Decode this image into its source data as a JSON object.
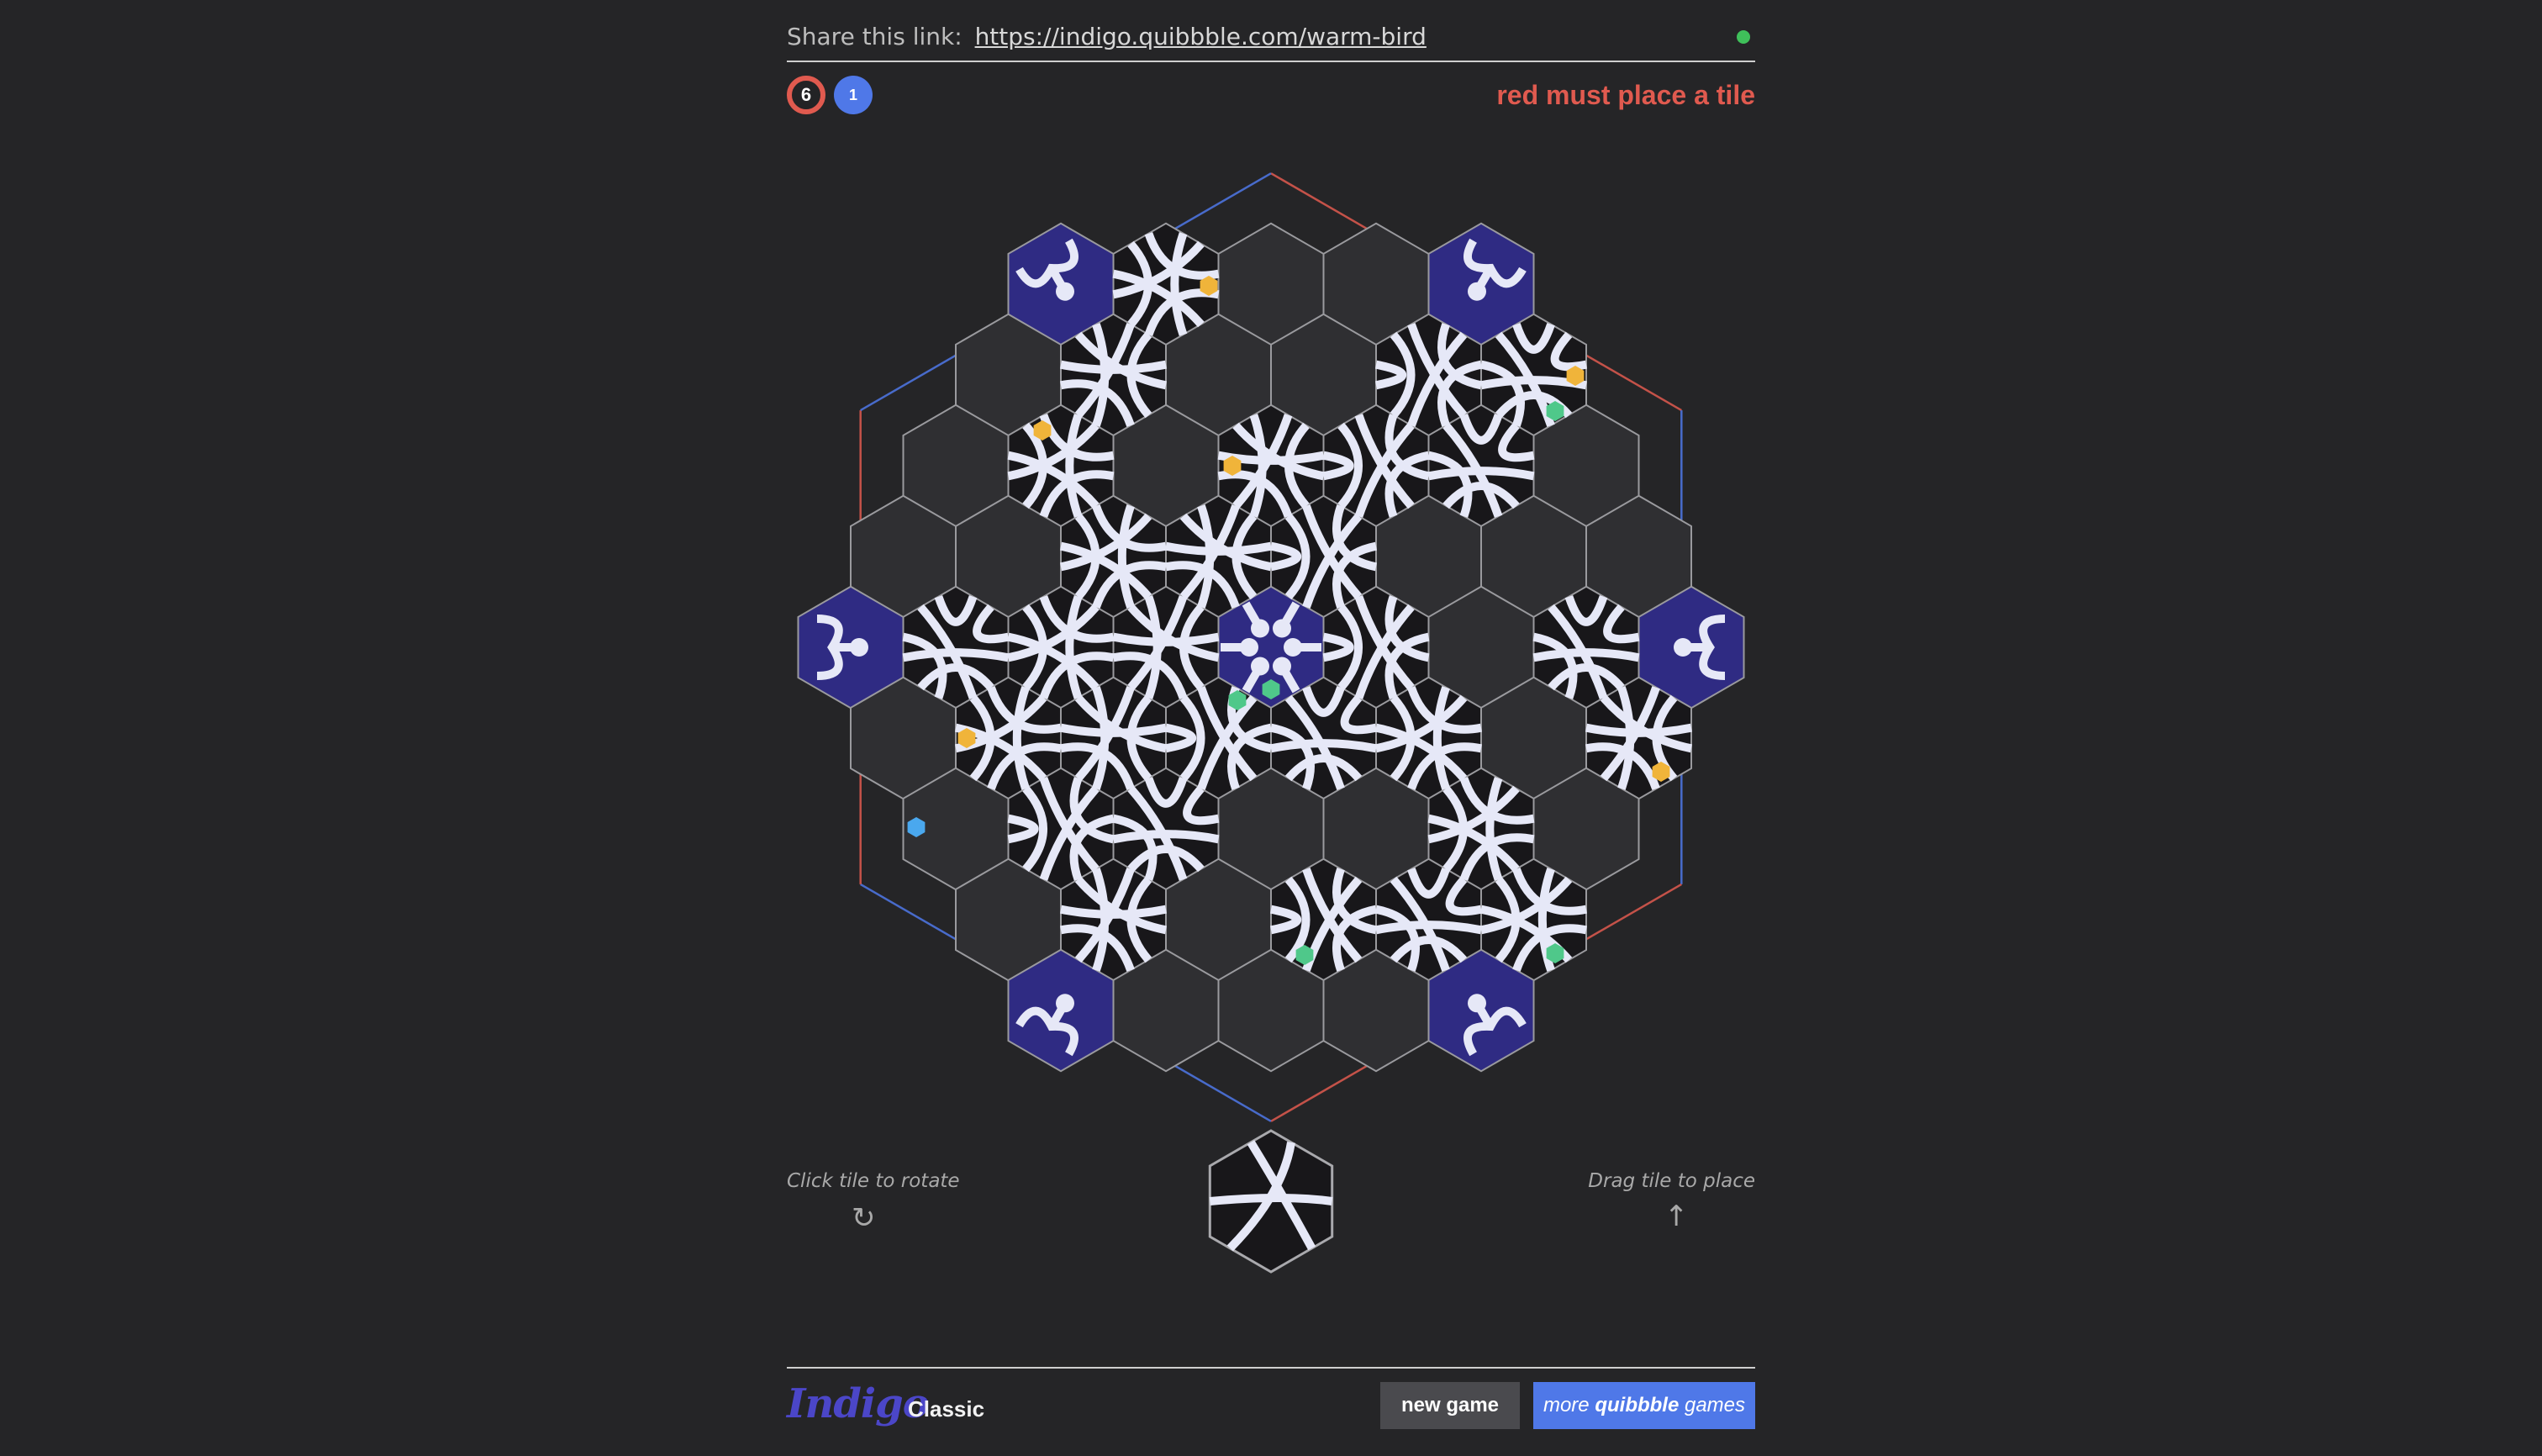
{
  "header": {
    "share_label": "Share this link:",
    "share_url": "https://indigo.quibbble.com/warm-bird",
    "connection_color": "#3fc05a"
  },
  "scores": {
    "red": "6",
    "blue": "1"
  },
  "turn_status": "red must place a tile",
  "colors": {
    "red": "#e05a4f",
    "blue": "#4f78e8",
    "gateway_tile": "#2f2b83",
    "path": "#e6e8f7",
    "tile": "#18171a",
    "gem_amber": "#f0b43a",
    "gem_emerald": "#4fc88a",
    "gem_sapphire": "#4aa8ee"
  },
  "board": {
    "gateway_tiles": [
      "top-left-corner",
      "top-right-corner",
      "left-corner",
      "right-corner",
      "bottom-left-corner",
      "bottom-right-corner",
      "center"
    ],
    "gems": [
      {
        "type": "amber",
        "color": "#f0b43a"
      },
      {
        "type": "amber",
        "color": "#f0b43a"
      },
      {
        "type": "amber",
        "color": "#f0b43a"
      },
      {
        "type": "amber",
        "color": "#f0b43a"
      },
      {
        "type": "amber",
        "color": "#f0b43a"
      },
      {
        "type": "amber",
        "color": "#f0b43a"
      },
      {
        "type": "emerald",
        "color": "#4fc88a"
      },
      {
        "type": "emerald",
        "color": "#4fc88a"
      },
      {
        "type": "emerald",
        "color": "#4fc88a"
      },
      {
        "type": "emerald",
        "color": "#4fc88a"
      },
      {
        "type": "emerald",
        "color": "#4fc88a"
      },
      {
        "type": "sapphire",
        "color": "#4aa8ee"
      }
    ]
  },
  "hints": {
    "rotate": "Click tile to rotate",
    "rotate_icon": "rotate-icon",
    "place": "Drag tile to place",
    "place_icon": "arrow-up-icon"
  },
  "footer": {
    "logo": "Indigo",
    "variant": "Classic",
    "new_game": "new game",
    "more_prefix": "more",
    "more_brand": "quibbble",
    "more_suffix": "games"
  }
}
